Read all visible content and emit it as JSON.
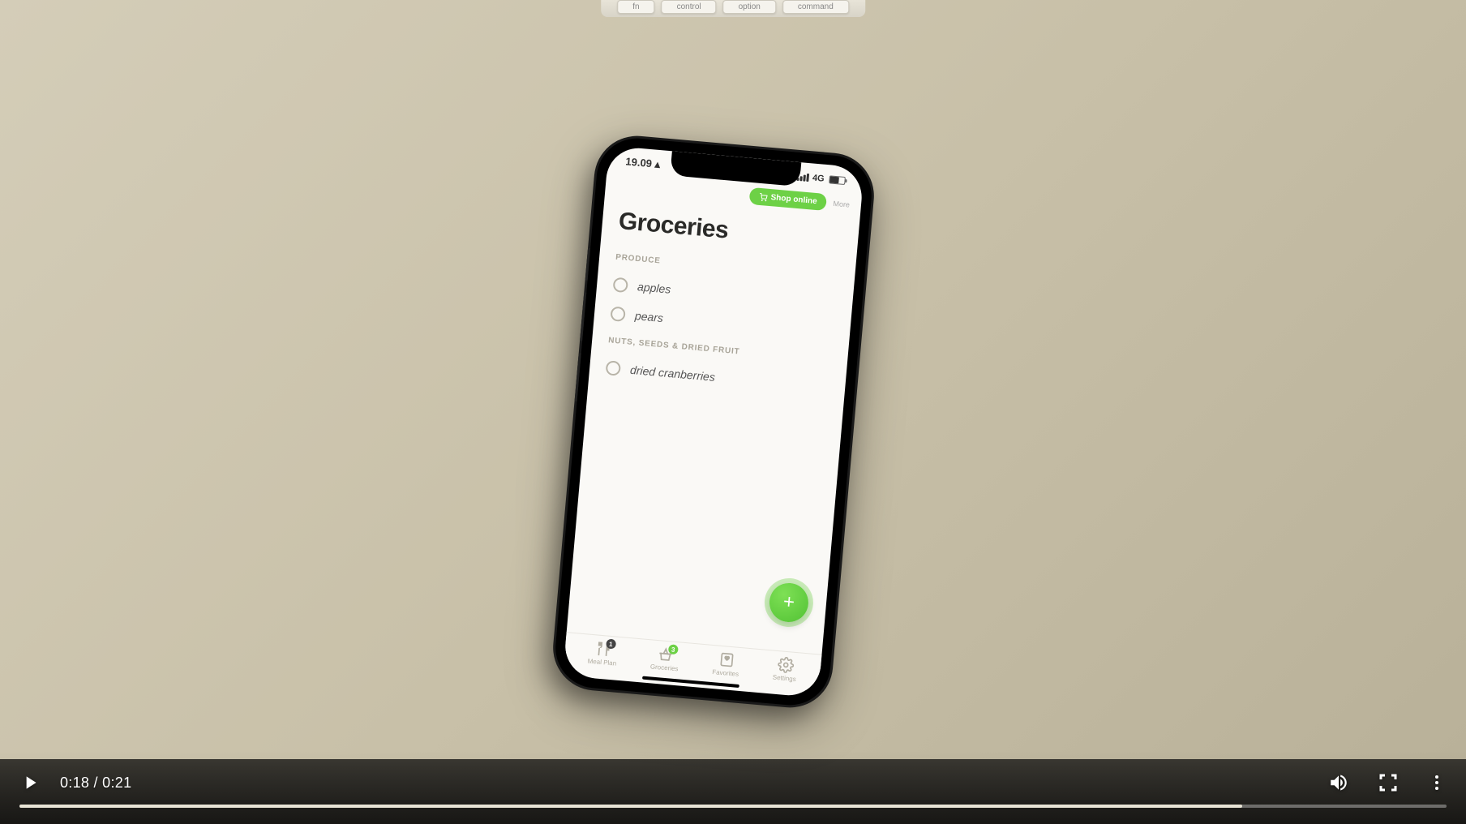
{
  "keyboard_keys": [
    "fn",
    "control",
    "option",
    "command"
  ],
  "status_bar": {
    "time": "19.09",
    "network": "4G"
  },
  "app_header": {
    "shop_label": "Shop online",
    "more_label": "More"
  },
  "page_title": "Groceries",
  "sections": [
    {
      "header": "PRODUCE",
      "items": [
        "apples",
        "pears"
      ]
    },
    {
      "header": "NUTS, SEEDS & DRIED FRUIT",
      "items": [
        "dried cranberries"
      ]
    }
  ],
  "fab_label": "+",
  "tabs": {
    "meal_plan": {
      "label": "Meal Plan",
      "badge": "1"
    },
    "groceries": {
      "label": "Groceries",
      "badge": "3"
    },
    "favorites": {
      "label": "Favorites"
    },
    "settings": {
      "label": "Settings"
    }
  },
  "video_player": {
    "current_time": "0:18",
    "separator": " / ",
    "duration": "0:21",
    "progress_percent": 85.7
  }
}
